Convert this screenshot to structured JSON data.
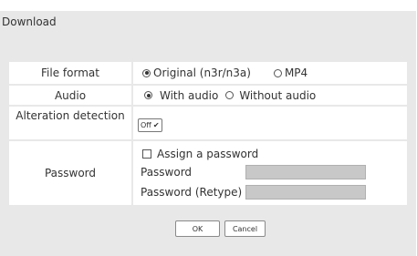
{
  "dialog": {
    "title": "Download"
  },
  "file_format": {
    "label": "File format",
    "options": [
      {
        "label": "Original (n3r/n3a)",
        "checked": true
      },
      {
        "label": "MP4",
        "checked": false
      }
    ]
  },
  "audio": {
    "label": "Audio",
    "options": [
      {
        "label": "With audio",
        "checked": true
      },
      {
        "label": "Without audio",
        "checked": false
      }
    ]
  },
  "alteration": {
    "label": "Alteration detection",
    "selected": "Off"
  },
  "password": {
    "label": "Password",
    "assign_label": "Assign a password",
    "assign_checked": false,
    "field_label": "Password",
    "retype_label": "Password (Retype)",
    "field_value": "",
    "retype_value": ""
  },
  "buttons": {
    "ok": "OK",
    "cancel": "Cancel"
  }
}
